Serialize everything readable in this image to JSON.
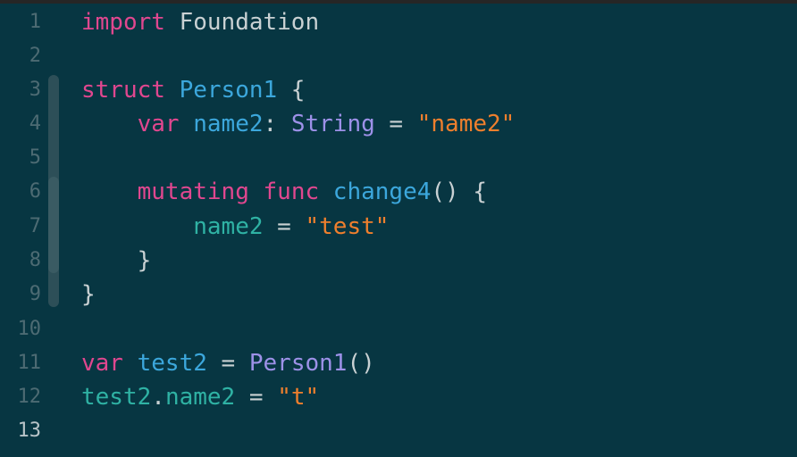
{
  "editor": {
    "current_line": 13,
    "line_numbers": [
      "1",
      "2",
      "3",
      "4",
      "5",
      "6",
      "7",
      "8",
      "9",
      "10",
      "11",
      "12",
      "13"
    ],
    "lines": [
      [
        {
          "text": "import",
          "kind": "keyword"
        },
        {
          "text": " Foundation",
          "kind": "plain"
        }
      ],
      [],
      [
        {
          "text": "struct",
          "kind": "keyword"
        },
        {
          "text": " ",
          "kind": "plain"
        },
        {
          "text": "Person1",
          "kind": "type-decl"
        },
        {
          "text": " {",
          "kind": "plain"
        }
      ],
      [
        {
          "text": "    ",
          "kind": "plain"
        },
        {
          "text": "var",
          "kind": "keyword"
        },
        {
          "text": " ",
          "kind": "plain"
        },
        {
          "text": "name2",
          "kind": "var-decl"
        },
        {
          "text": ": ",
          "kind": "plain"
        },
        {
          "text": "String",
          "kind": "type-ref"
        },
        {
          "text": " = ",
          "kind": "plain"
        },
        {
          "text": "\"name2\"",
          "kind": "string"
        }
      ],
      [],
      [
        {
          "text": "    ",
          "kind": "plain"
        },
        {
          "text": "mutating",
          "kind": "keyword"
        },
        {
          "text": " ",
          "kind": "plain"
        },
        {
          "text": "func",
          "kind": "keyword"
        },
        {
          "text": " ",
          "kind": "plain"
        },
        {
          "text": "change4",
          "kind": "func-decl"
        },
        {
          "text": "() {",
          "kind": "plain"
        }
      ],
      [
        {
          "text": "        ",
          "kind": "plain"
        },
        {
          "text": "name2",
          "kind": "prop"
        },
        {
          "text": " = ",
          "kind": "plain"
        },
        {
          "text": "\"test\"",
          "kind": "string"
        }
      ],
      [
        {
          "text": "    }",
          "kind": "plain"
        }
      ],
      [
        {
          "text": "}",
          "kind": "plain"
        }
      ],
      [],
      [
        {
          "text": "var",
          "kind": "keyword"
        },
        {
          "text": " ",
          "kind": "plain"
        },
        {
          "text": "test2",
          "kind": "var-decl"
        },
        {
          "text": " = ",
          "kind": "plain"
        },
        {
          "text": "Person1",
          "kind": "type-ref"
        },
        {
          "text": "()",
          "kind": "plain"
        }
      ],
      [
        {
          "text": "test2",
          "kind": "prop"
        },
        {
          "text": ".",
          "kind": "plain"
        },
        {
          "text": "name2",
          "kind": "prop"
        },
        {
          "text": " = ",
          "kind": "plain"
        },
        {
          "text": "\"t\"",
          "kind": "string"
        }
      ],
      []
    ]
  },
  "colors": {
    "background": "#073642",
    "keyword": "#e0478f",
    "plain": "#c9d1d3",
    "type_decl": "#3ca7dc",
    "type_ref": "#9d91e8",
    "property": "#2fb2a4",
    "string": "#ef7f2d",
    "line_number": "#4d6b73",
    "line_number_current": "#b8c4c8"
  }
}
